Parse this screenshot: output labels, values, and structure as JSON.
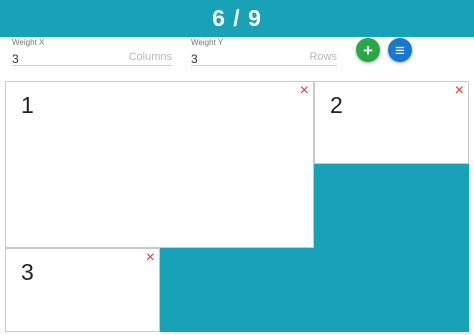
{
  "header": {
    "counter": "6 / 9"
  },
  "controls": {
    "weight_x": {
      "label": "Weight X",
      "value": "3",
      "unit": "Columns"
    },
    "weight_y": {
      "label": "Weight Y",
      "value": "3",
      "unit": "Rows"
    },
    "add_icon": "+",
    "sort_icon": "≡"
  },
  "tiles": [
    {
      "label": "1",
      "close": "×"
    },
    {
      "label": "2",
      "close": "×"
    },
    {
      "label": "3",
      "close": "×"
    }
  ],
  "colors": {
    "accent": "#17a2b8",
    "add_button": "#28a745",
    "sort_button": "#1976d2",
    "close": "#e53935"
  }
}
